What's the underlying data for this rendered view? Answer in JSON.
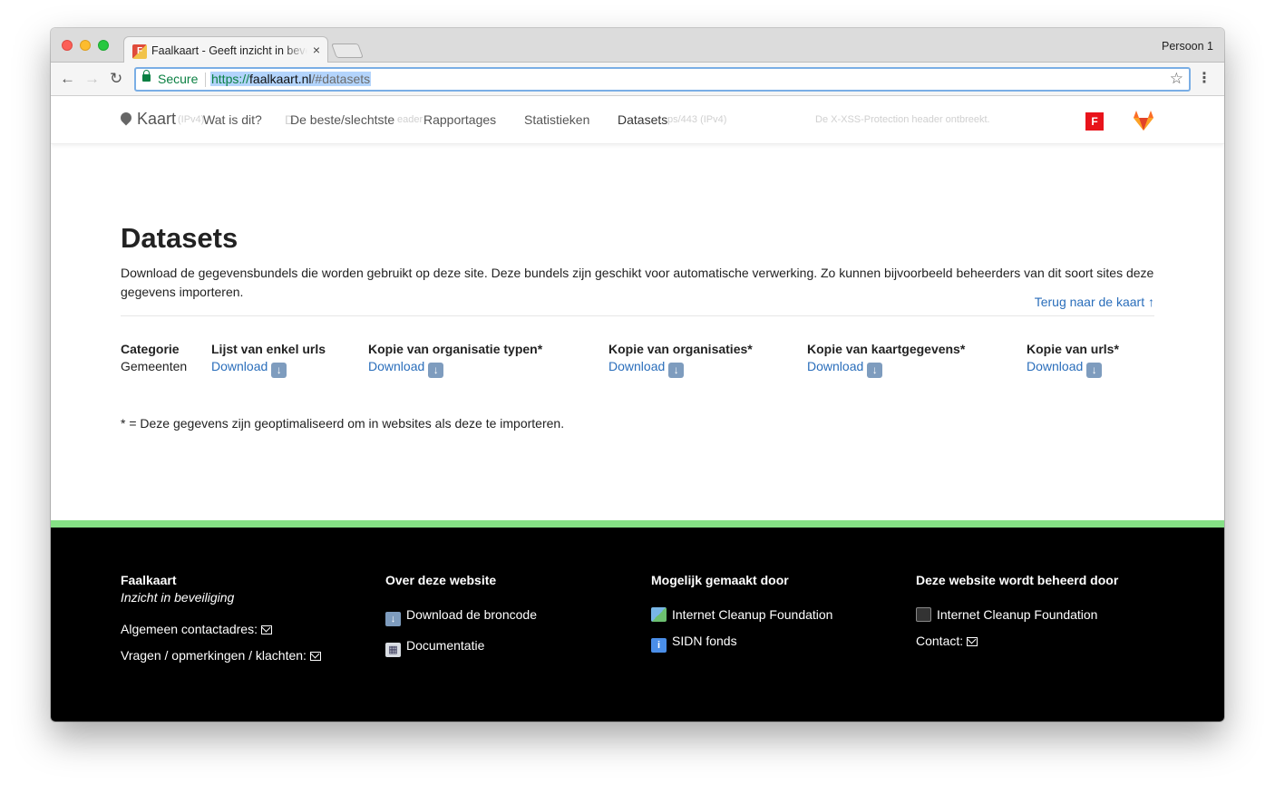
{
  "browser": {
    "tab_title": "Faalkaart - Geeft inzicht in beveiliging",
    "tab_close": "×",
    "profile": "Persoon 1",
    "security_label": "Secure",
    "url_protocol": "https://",
    "url_host": "faalkaart.nl",
    "url_path": "/#datasets"
  },
  "site_nav": {
    "brand": "Kaart",
    "items": [
      "Wat is dit?",
      "De beste/slechtste",
      "Rapportages",
      "Statistieken",
      "Datasets"
    ],
    "ghost_texts": [
      "(IPv4)",
      "D",
      "eader",
      "ps/443 (IPv4)",
      "De X-XSS-Protection header ontbreekt."
    ]
  },
  "main": {
    "title": "Datasets",
    "intro": "Download de gegevensbundels die worden gebruikt op deze site. Deze bundels zijn geschikt voor automatische verwerking. Zo kunnen bijvoorbeeld beheerders van dit soort sites deze gegevens importeren.",
    "back_link": "Terug naar de kaart ↑",
    "category_header": "Categorie",
    "category_value": "Gemeenten",
    "columns": [
      {
        "header": "Lijst van enkel urls",
        "link": "Download"
      },
      {
        "header": "Kopie van organisatie typen*",
        "link": "Download"
      },
      {
        "header": "Kopie van organisaties*",
        "link": "Download"
      },
      {
        "header": "Kopie van kaartgegevens*",
        "link": "Download"
      },
      {
        "header": "Kopie van urls*",
        "link": "Download"
      }
    ],
    "footnote": "* = Deze gegevens zijn geoptimaliseerd om in websites als deze te importeren."
  },
  "footer": {
    "col1": {
      "title": "Faalkaart",
      "tagline": "Inzicht in beveiliging",
      "contact_general": "Algemeen contactadres:",
      "contact_feedback": "Vragen / opmerkingen / klachten:"
    },
    "col2": {
      "title": "Over deze website",
      "links": [
        "Download de broncode",
        "Documentatie"
      ]
    },
    "col3": {
      "title": "Mogelijk gemaakt door",
      "links": [
        "Internet Cleanup Foundation",
        "SIDN fonds"
      ]
    },
    "col4": {
      "title": "Deze website wordt beheerd door",
      "links": [
        "Internet Cleanup Foundation",
        "Contact:"
      ]
    }
  },
  "colors": {
    "link": "#2a6ebb",
    "green_bar": "#85e085",
    "footer_bg": "#000000",
    "fa_badge": "#e8131b"
  }
}
